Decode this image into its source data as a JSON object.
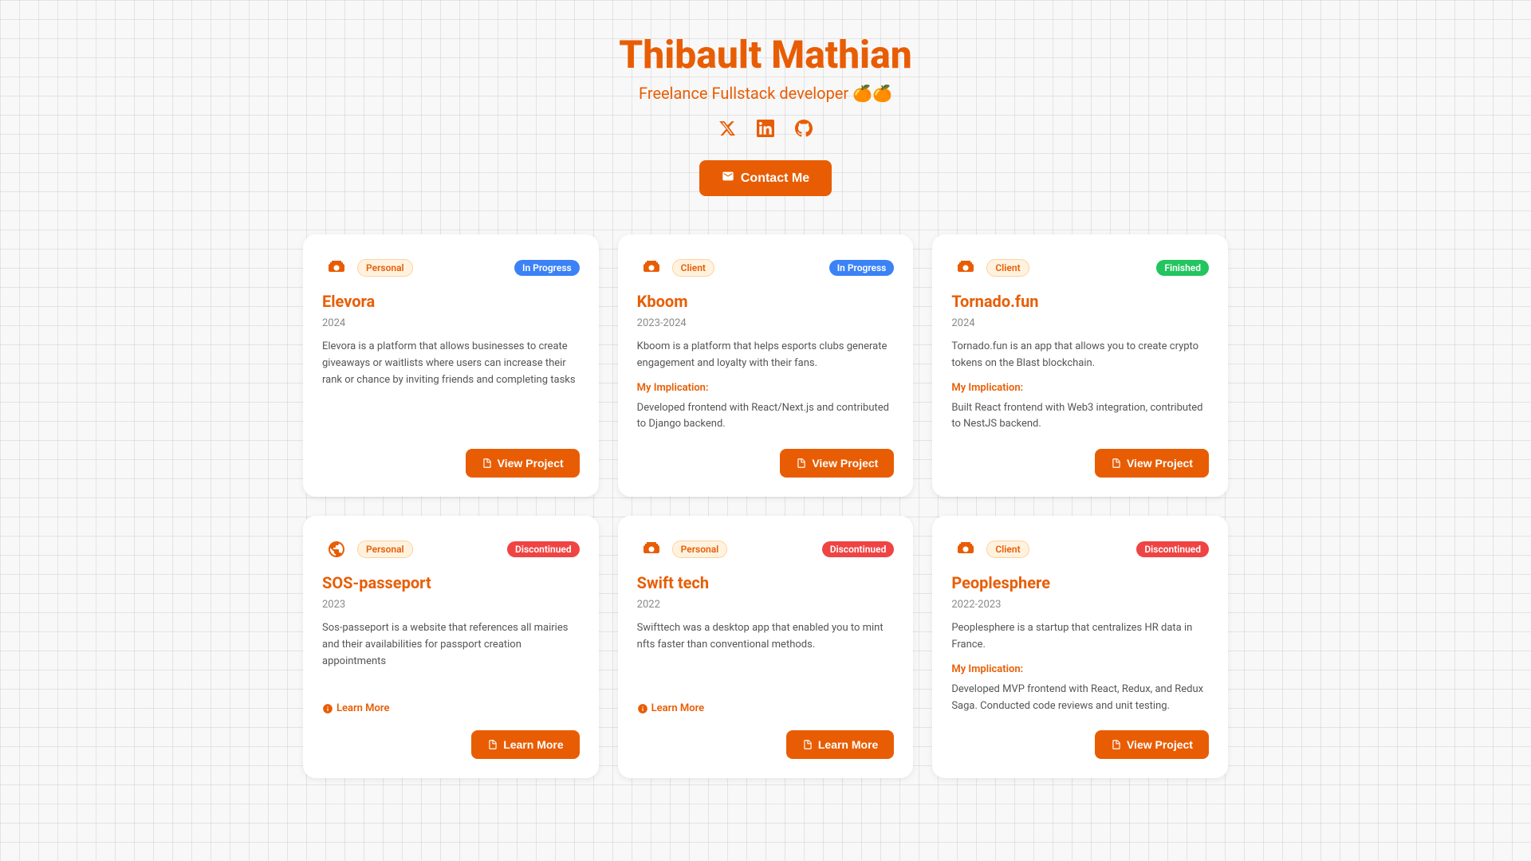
{
  "header": {
    "name": "Thibault Mathian",
    "subtitle": "Freelance Fullstack developer 🍊🍊",
    "social": {
      "twitter_icon": "𝕏",
      "linkedin_icon": "in",
      "github_icon": "⌥"
    },
    "contact_button_label": "Contact Me",
    "contact_icon": "✉"
  },
  "cards": [
    {
      "id": "elevora",
      "icon": "📦",
      "tag": "Personal",
      "tag_type": "personal",
      "status": "In Progress",
      "status_type": "in-progress",
      "title": "Elevora",
      "year": "2024",
      "description": "Elevora is a platform that allows businesses to create giveaways or waitlists where users can increase their rank or chance by inviting friends and completing tasks",
      "implication_label": "",
      "implication_text": "",
      "button_label": "View Project",
      "button_type": "view"
    },
    {
      "id": "kboom",
      "icon": "📦",
      "tag": "Client",
      "tag_type": "client",
      "status": "In Progress",
      "status_type": "in-progress",
      "title": "Kboom",
      "year": "2023-2024",
      "description": "Kboom is a platform that helps esports clubs generate engagement and loyalty with their fans.",
      "implication_label": "My Implication:",
      "implication_text": "Developed frontend with React/Next.js and contributed to Django backend.",
      "button_label": "View Project",
      "button_type": "view"
    },
    {
      "id": "tornado",
      "icon": "📦",
      "tag": "Client",
      "tag_type": "client",
      "status": "Finished",
      "status_type": "finished",
      "title": "Tornado.fun",
      "year": "2024",
      "description": "Tornado.fun is an app that allows you to create crypto tokens on the Blast blockchain.",
      "implication_label": "My Implication:",
      "implication_text": "Built React frontend with Web3 integration, contributed to NestJS backend.",
      "button_label": "View Project",
      "button_type": "view"
    },
    {
      "id": "sos-passeport",
      "icon": "🌐",
      "tag": "Personal",
      "tag_type": "personal",
      "status": "Discontinued",
      "status_type": "discontinued",
      "title": "SOS-passeport",
      "year": "2023",
      "description": "Sos-passeport is a website that references all mairies and their availabilities for passport creation appointments",
      "implication_label": "",
      "implication_text": "",
      "learn_more_label": "Learn More",
      "button_label": "Learn More",
      "button_type": "learn"
    },
    {
      "id": "swift-tech",
      "icon": "📦",
      "tag": "Personal",
      "tag_type": "personal",
      "status": "Discontinued",
      "status_type": "discontinued",
      "title": "Swift tech",
      "year": "2022",
      "description": "Swifttech was a desktop app that enabled you to mint nfts faster than conventional methods.",
      "implication_label": "",
      "implication_text": "",
      "learn_more_label": "Learn More",
      "button_label": "Learn More",
      "button_type": "learn"
    },
    {
      "id": "peoplesphere",
      "icon": "📦",
      "tag": "Client",
      "tag_type": "client",
      "status": "Discontinued",
      "status_type": "discontinued",
      "title": "Peoplesphere",
      "year": "2022-2023",
      "description": "Peoplesphere is a startup that centralizes HR data in France.",
      "implication_label": "My Implication:",
      "implication_text": "Developed MVP frontend with React, Redux, and Redux Saga. Conducted code reviews and unit testing.",
      "button_label": "View Project",
      "button_type": "view"
    }
  ],
  "icons": {
    "mail": "✉",
    "document": "📄",
    "warning": "⚠",
    "package": "📦",
    "globe": "🌐"
  }
}
